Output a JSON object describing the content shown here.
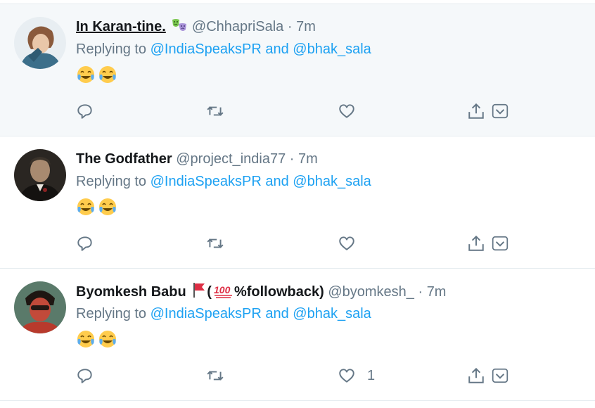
{
  "tweets": [
    {
      "name": "In Karan-tine.",
      "handle": "@ChhapriSala",
      "time": "7m",
      "replying_label": "Replying to",
      "replying_to_1": "@IndiaSpeaksPR",
      "and_label": "and",
      "replying_to_2": "@bhak_sala",
      "like_count": ""
    },
    {
      "name": "The Godfather",
      "handle": "@project_india77",
      "time": "7m",
      "replying_label": "Replying to",
      "replying_to_1": "@IndiaSpeaksPR",
      "and_label": "and",
      "replying_to_2": "@bhak_sala",
      "like_count": ""
    },
    {
      "name": "Byomkesh Babu",
      "name_suffix": "%followback)",
      "name_open_paren": "(",
      "handle": "@byomkesh_",
      "time": "7m",
      "replying_label": "Replying to",
      "replying_to_1": "@IndiaSpeaksPR",
      "and_label": "and",
      "replying_to_2": "@bhak_sala",
      "like_count": "1"
    }
  ],
  "separator": "·",
  "icons": [
    "reply-icon",
    "retweet-icon",
    "like-icon",
    "share-icon",
    "chevron-down-icon"
  ],
  "colors": {
    "link": "#1da1f2",
    "muted": "#657786",
    "hover_bg": "#f5f8fa"
  }
}
